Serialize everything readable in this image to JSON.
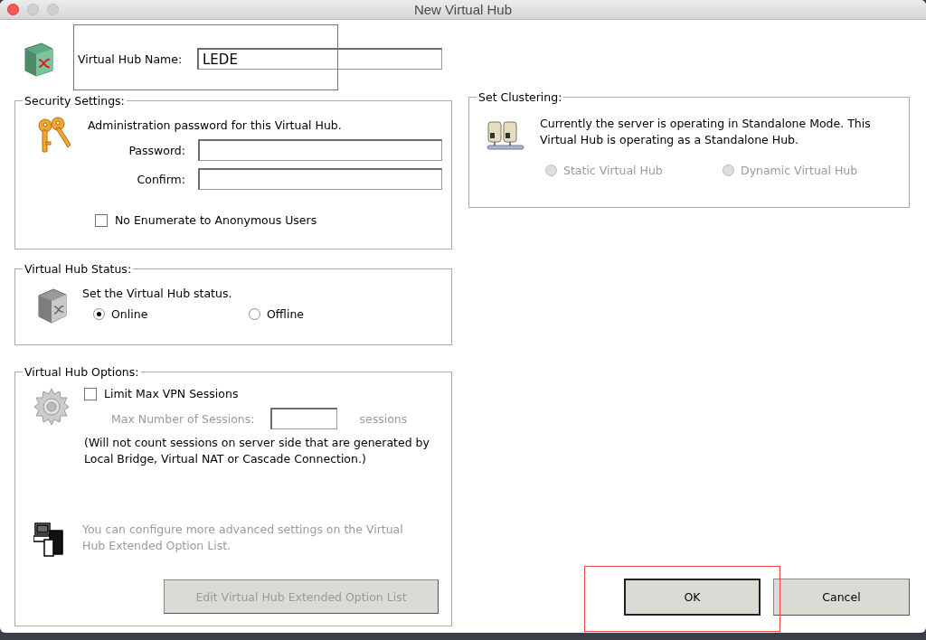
{
  "window": {
    "title": "New Virtual Hub"
  },
  "hub_name": {
    "label": "Virtual Hub Name:",
    "value": "LEDE"
  },
  "security_settings": {
    "title": "Security Settings:",
    "description": "Administration password for this Virtual Hub.",
    "fields": [
      {
        "label": "Password:"
      },
      {
        "label": "Confirm:"
      }
    ],
    "checkbox": {
      "label": "No Enumerate to Anonymous Users",
      "checked": false
    }
  },
  "virtual_hub_status": {
    "title": "Virtual Hub Status:",
    "description": "Set the Virtual Hub status.",
    "options": [
      {
        "label": "Online",
        "selected": true,
        "disabled": false
      },
      {
        "label": "Offline",
        "selected": false,
        "disabled": false
      }
    ]
  },
  "virtual_hub_options": {
    "title": "Virtual Hub Options:",
    "checkbox": {
      "label": "Limit Max VPN Sessions",
      "checked": false
    },
    "max_sessions": {
      "label": "Max Number of Sessions:",
      "unit": "sessions",
      "disabled": true
    },
    "note": "(Will not count sessions on server side that are generated by Local Bridge, Virtual NAT or Cascade Connection.)",
    "extended_description": "You can configure more advanced settings on the Virtual Hub Extended Option List.",
    "extended_button": {
      "label": "Edit Virtual Hub Extended Option List",
      "disabled": true
    }
  },
  "set_clustering": {
    "title": "Set Clustering:",
    "description": "Currently the server is operating in Standalone Mode. This Virtual Hub is operating as a Standalone Hub.",
    "options": [
      {
        "label": "Static Virtual Hub",
        "selected": false,
        "disabled": true
      },
      {
        "label": "Dynamic Virtual Hub",
        "selected": false,
        "disabled": true
      }
    ]
  },
  "buttons": [
    {
      "label": "OK",
      "default": true
    },
    {
      "label": "Cancel",
      "default": false
    }
  ]
}
